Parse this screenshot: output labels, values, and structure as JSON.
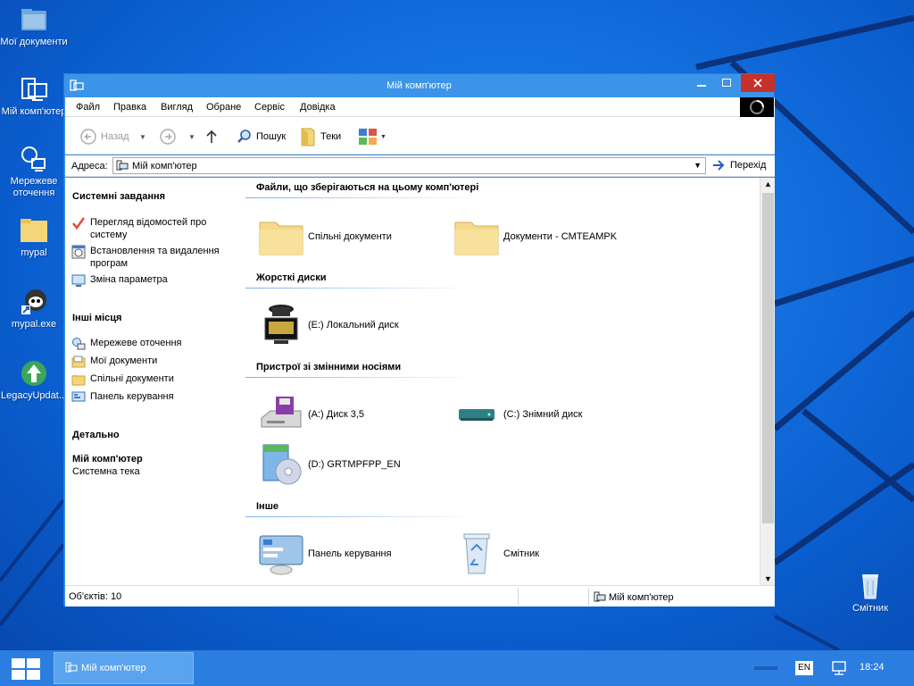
{
  "desktop": {
    "icons": [
      {
        "label": "Мої документи"
      },
      {
        "label": "Мій комп'ютер"
      },
      {
        "label": "Мережеве оточення"
      },
      {
        "label": "mypal"
      },
      {
        "label": "mypal.exe"
      },
      {
        "label": "LegacyUpdat..."
      },
      {
        "label": "Смітник"
      }
    ]
  },
  "window": {
    "title": "Мій комп'ютер",
    "menu": [
      "Файл",
      "Правка",
      "Вигляд",
      "Обране",
      "Сервіс",
      "Довідка"
    ],
    "toolbar": {
      "back": "Назад",
      "search": "Пошук",
      "folders": "Теки"
    },
    "address": {
      "label": "Адреса:",
      "value": "Мій комп'ютер",
      "go": "Перехід"
    },
    "taskpane": {
      "system_tasks": {
        "title": "Системні завдання",
        "items": [
          "Перегляд відомостей про систему",
          "Встановлення та видалення програм",
          "Зміна параметра"
        ]
      },
      "other_places": {
        "title": "Інші місця",
        "items": [
          "Мережеве оточення",
          "Мої документи",
          "Спільні документи",
          "Панель керування"
        ]
      },
      "details": {
        "title": "Детально",
        "name": "Мій комп'ютер",
        "type": "Системна тека"
      }
    },
    "content": {
      "groups": [
        {
          "title": "Файли, що зберігаються на цьому комп'ютері",
          "items": [
            "Спільні документи",
            "Документи - CMTEAMPK"
          ]
        },
        {
          "title": "Жорсткі диски",
          "items": [
            "(E:) Локальний диск"
          ]
        },
        {
          "title": "Пристрої зі змінними носіями",
          "items": [
            "(A:) Диск 3,5",
            "(C:) Знімний диск",
            "(D:) GRTMPFPP_EN"
          ]
        },
        {
          "title": "Інше",
          "items": [
            "Панель керування",
            "Смітник"
          ]
        }
      ]
    },
    "status": {
      "objects": "Об'єктів: 10",
      "location": "Мій комп'ютер"
    }
  },
  "taskbar": {
    "task_label": "Мій комп'ютер",
    "lang": "EN",
    "clock": "18:24"
  },
  "colors": {
    "desktop": "#1572e2",
    "titlebar": "#3b94e8",
    "close": "#c7312b",
    "taskbar": "#2b7de0"
  }
}
